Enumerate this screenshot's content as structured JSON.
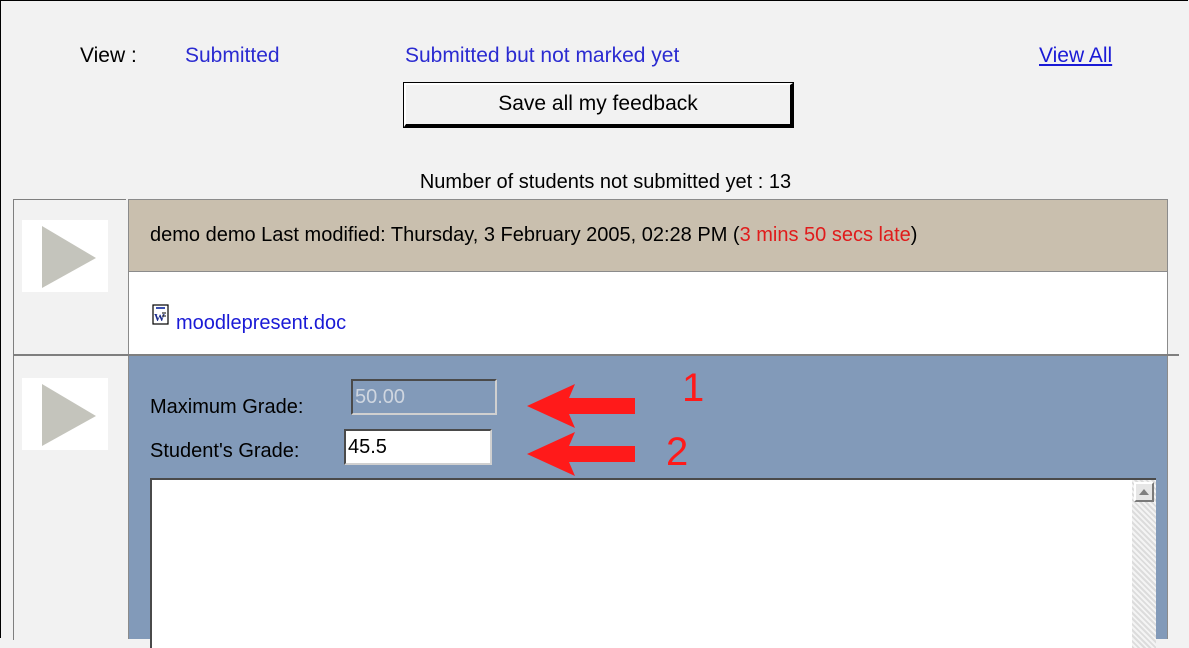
{
  "viewbar": {
    "label": "View :",
    "links": [
      "Submitted",
      "Submitted but not marked yet",
      "View All"
    ]
  },
  "save_button": "Save all my feedback",
  "not_submitted": "Number of students not submitted yet : 13",
  "submission": {
    "header_text": "demo demo  Last modified: Thursday, 3 February 2005, 02:28 PM (",
    "late_text": "3 mins 50 secs late",
    "header_close": ")",
    "file_name": "moodlepresent.doc"
  },
  "grading": {
    "max_label": "Maximum Grade:",
    "max_value": "50.00",
    "student_label": "Student's Grade:",
    "student_value": "45.5",
    "feedback_text": ""
  },
  "annotations": {
    "one": "1",
    "two": "2",
    "color": "#ff1a1a"
  },
  "colors": {
    "link": "#1a1ad6",
    "header_bg": "#c9bfae",
    "grade_bg": "#829ab9",
    "late": "#e01b1b"
  },
  "icons": [
    "expand-triangle-icon",
    "word-doc-icon",
    "scroll-up-arrow-icon",
    "red-arrow-icon"
  ]
}
